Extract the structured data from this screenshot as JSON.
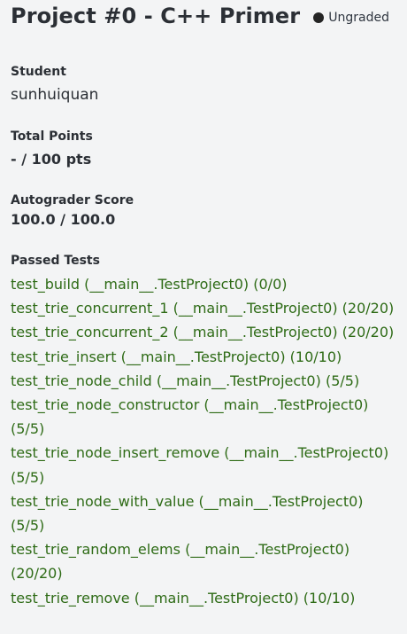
{
  "header": {
    "title": "Project #0 - C++ Primer",
    "status": "Ungraded"
  },
  "student": {
    "label": "Student",
    "value": "sunhuiquan"
  },
  "total_points": {
    "label": "Total Points",
    "value": "- / 100 pts"
  },
  "autograder_score": {
    "label": "Autograder Score",
    "value": "100.0 / 100.0"
  },
  "passed_tests": {
    "label": "Passed Tests",
    "items": [
      {
        "name": "test_build",
        "suite": "(__main__.TestProject0)",
        "score": "(0/0)"
      },
      {
        "name": "test_trie_concurrent_1",
        "suite": "(__main__.TestProject0)",
        "score": "(20/20)"
      },
      {
        "name": "test_trie_concurrent_2",
        "suite": "(__main__.TestProject0)",
        "score": "(20/20)"
      },
      {
        "name": "test_trie_insert",
        "suite": "(__main__.TestProject0)",
        "score": "(10/10)"
      },
      {
        "name": "test_trie_node_child",
        "suite": "(__main__.TestProject0)",
        "score": "(5/5)"
      },
      {
        "name": "test_trie_node_constructor",
        "suite": "(__main__.TestProject0)",
        "score": "(5/5)"
      },
      {
        "name": "test_trie_node_insert_remove",
        "suite": "(__main__.TestProject0)",
        "score": "(5/5)"
      },
      {
        "name": "test_trie_node_with_value",
        "suite": "(__main__.TestProject0)",
        "score": "(5/5)"
      },
      {
        "name": "test_trie_random_elems",
        "suite": "(__main__.TestProject0)",
        "score": "(20/20)"
      },
      {
        "name": "test_trie_remove",
        "suite": "(__main__.TestProject0)",
        "score": "(10/10)"
      }
    ]
  },
  "colors": {
    "background": "#f3f4f5",
    "text": "#2b2f35",
    "test_green": "#2e6b16",
    "status_dot": "#242424"
  },
  "icons": {
    "status_indicator": "ungraded-status-dot-icon"
  }
}
